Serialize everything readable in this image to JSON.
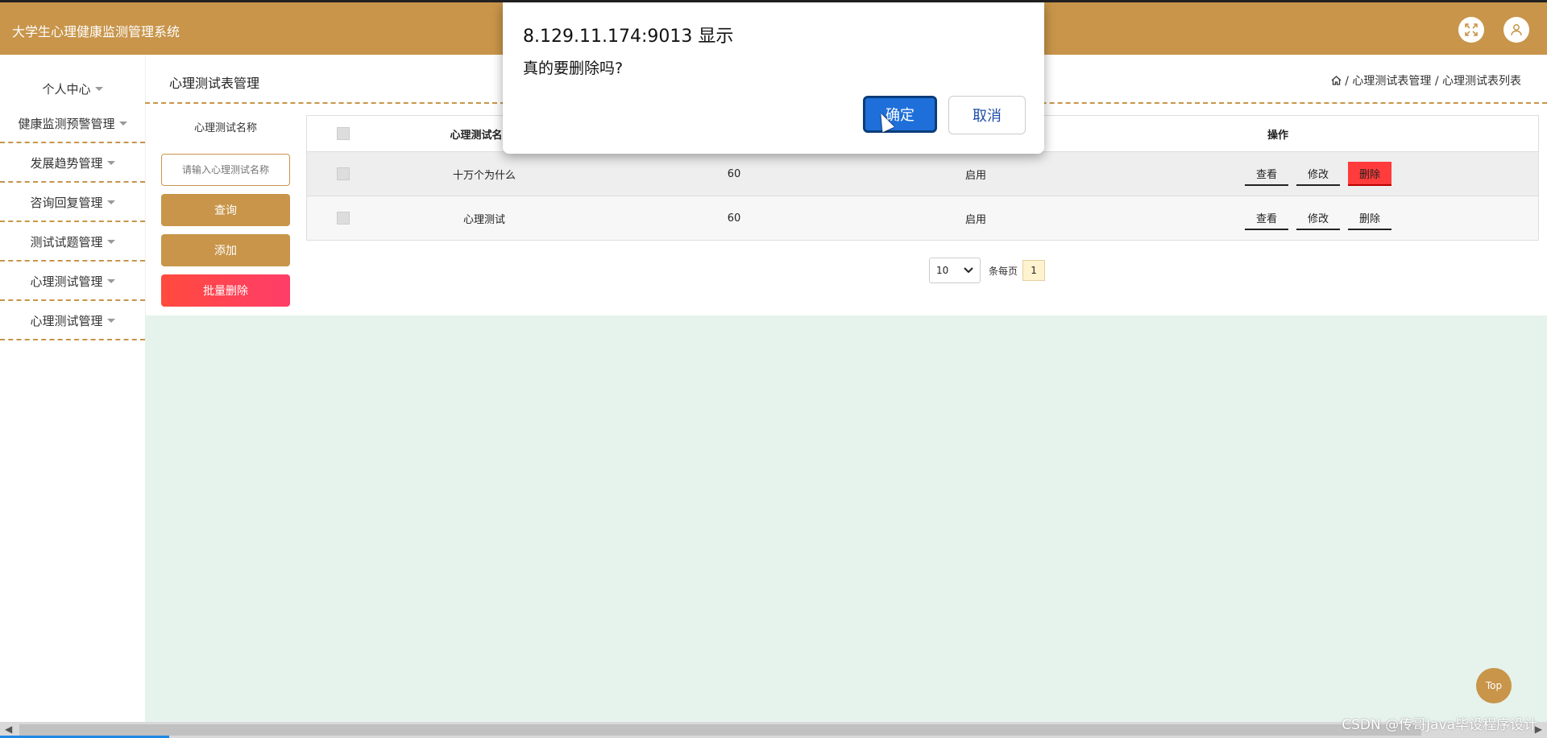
{
  "app": {
    "title": "大学生心理健康监测管理系统"
  },
  "sidebar": {
    "items": [
      {
        "label": "个人中心"
      },
      {
        "label": "健康监测预警管理"
      },
      {
        "label": "发展趋势管理"
      },
      {
        "label": "咨询回复管理"
      },
      {
        "label": "测试试题管理"
      },
      {
        "label": "心理测试管理"
      },
      {
        "label": "心理测试管理"
      }
    ]
  },
  "page": {
    "heading": "心理测试表管理",
    "breadcrumb": "/ 心理测试表管理 / 心理测试表列表"
  },
  "search": {
    "label": "心理测试名称",
    "placeholder": "请输入心理测试名称",
    "query_label": "查询",
    "add_label": "添加",
    "bulk_delete_label": "批量删除"
  },
  "table": {
    "headers": {
      "name": "心理测试名",
      "actions": "操作"
    },
    "rows": [
      {
        "name": "十万个为什么",
        "score": "60",
        "status": "启用"
      },
      {
        "name": "心理测试",
        "score": "60",
        "status": "启用"
      }
    ],
    "actions": {
      "view": "查看",
      "edit": "修改",
      "delete": "删除"
    }
  },
  "pager": {
    "page_size": "10",
    "per_page_label": "条每页",
    "current_page": "1"
  },
  "dialog": {
    "title": "8.129.11.174:9013 显示",
    "message": "真的要删除吗?",
    "ok_label": "确定",
    "cancel_label": "取消"
  },
  "top_button": {
    "label": "Top"
  },
  "watermark": "CSDN @传哥Java毕设程序设计",
  "colors": {
    "brand": "#c8954a",
    "danger": "#ff3b3b",
    "content_bg": "#e5f3ec",
    "primary": "#1e6fd9"
  }
}
